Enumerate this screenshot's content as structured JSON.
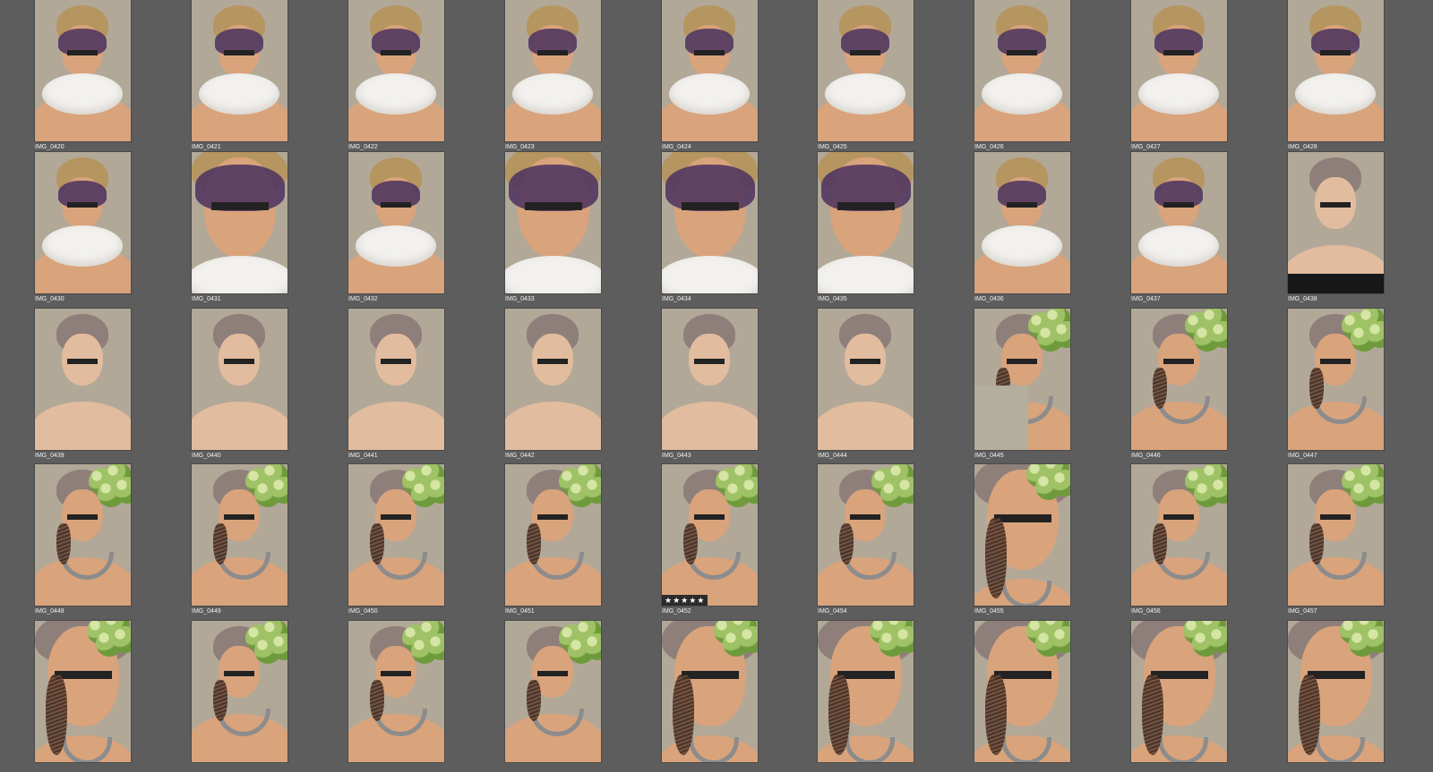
{
  "grid": {
    "rows": [
      [
        {
          "label": "IMG_0420",
          "type": "mask-ruff"
        },
        {
          "label": "IMG_0421",
          "type": "mask-ruff"
        },
        {
          "label": "IMG_0422",
          "type": "mask-ruff"
        },
        {
          "label": "IMG_0423",
          "type": "mask-ruff"
        },
        {
          "label": "IMG_0424",
          "type": "mask-ruff"
        },
        {
          "label": "IMG_0425",
          "type": "mask-ruff"
        },
        {
          "label": "IMG_0426",
          "type": "mask-ruff"
        },
        {
          "label": "IMG_0427",
          "type": "mask-ruff"
        },
        {
          "label": "IMG_0428",
          "type": "mask-ruff"
        }
      ],
      [
        {
          "label": "IMG_0430",
          "type": "mask-ruff"
        },
        {
          "label": "IMG_0431",
          "type": "mask-ruff-close"
        },
        {
          "label": "IMG_0432",
          "type": "mask-ruff"
        },
        {
          "label": "IMG_0433",
          "type": "mask-ruff-close"
        },
        {
          "label": "IMG_0434",
          "type": "mask-ruff-close"
        },
        {
          "label": "IMG_0435",
          "type": "mask-ruff-close"
        },
        {
          "label": "IMG_0436",
          "type": "mask-ruff"
        },
        {
          "label": "IMG_0437",
          "type": "mask-ruff"
        },
        {
          "label": "IMG_0438",
          "type": "plain-dress"
        }
      ],
      [
        {
          "label": "IMG_0439",
          "type": "plain"
        },
        {
          "label": "IMG_0440",
          "type": "plain"
        },
        {
          "label": "IMG_0441",
          "type": "plain"
        },
        {
          "label": "IMG_0442",
          "type": "plain"
        },
        {
          "label": "IMG_0443",
          "type": "plain"
        },
        {
          "label": "IMG_0444",
          "type": "plain"
        },
        {
          "label": "IMG_0445",
          "type": "flower-partial"
        },
        {
          "label": "IMG_0446",
          "type": "flower"
        },
        {
          "label": "IMG_0447",
          "type": "flower"
        }
      ],
      [
        {
          "label": "IMG_0448",
          "type": "flower"
        },
        {
          "label": "IMG_0449",
          "type": "flower"
        },
        {
          "label": "IMG_0450",
          "type": "flower"
        },
        {
          "label": "IMG_0451",
          "type": "flower"
        },
        {
          "label": "IMG_0452",
          "type": "flower",
          "rating": "★★★★★"
        },
        {
          "label": "IMG_0454",
          "type": "flower"
        },
        {
          "label": "IMG_0455",
          "type": "flower-close"
        },
        {
          "label": "IMG_0456",
          "type": "flower"
        },
        {
          "label": "IMG_0457",
          "type": "flower"
        }
      ],
      [
        {
          "label": "",
          "type": "flower-close"
        },
        {
          "label": "",
          "type": "flower"
        },
        {
          "label": "",
          "type": "flower"
        },
        {
          "label": "",
          "type": "flower"
        },
        {
          "label": "",
          "type": "flower-close"
        },
        {
          "label": "",
          "type": "flower-close"
        },
        {
          "label": "",
          "type": "flower-close"
        },
        {
          "label": "",
          "type": "flower-close"
        },
        {
          "label": "",
          "type": "flower-close"
        }
      ]
    ]
  },
  "colors": {
    "background": "#5d5d5d",
    "backdrop": "#b2a898",
    "skin": "#d9a37c",
    "skin_plain": "#e2bc9e",
    "hair_blonde": "#b59560",
    "hair_plain": "#8e7f7a",
    "mask": "#4f3460",
    "label": "#f0f0f0"
  }
}
